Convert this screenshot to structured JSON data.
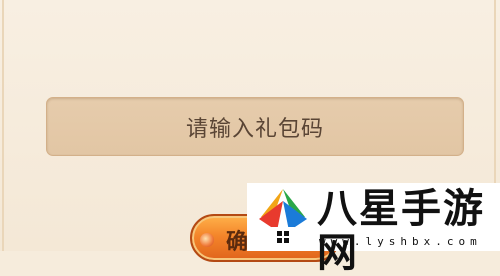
{
  "gift_code": {
    "placeholder": "请输入礼包码"
  },
  "confirm_button": {
    "label": "确"
  },
  "watermark": {
    "title": "八星手游网",
    "url": "www.lyshbx.com"
  },
  "colors": {
    "panel_background": "#f6ecdc",
    "input_background": "#e4c9a8",
    "input_text": "#5a4535",
    "button_orange": "#f4852a",
    "button_border": "#b44a14"
  }
}
